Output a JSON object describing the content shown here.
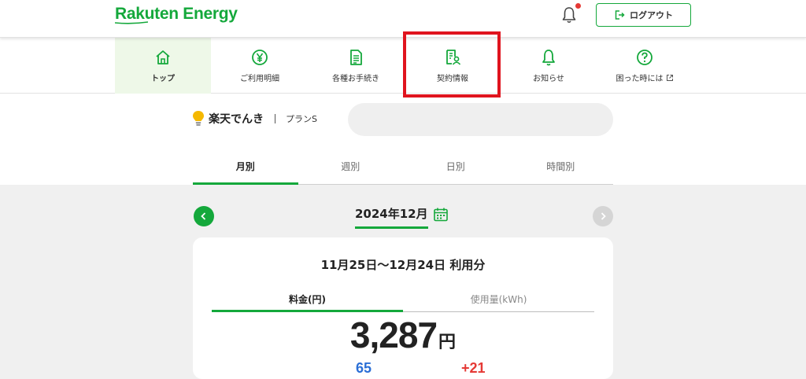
{
  "header": {
    "logo_text": "Rakuten Energy",
    "logout_label": "ログアウト",
    "brand_color": "#14a83b",
    "notification_dot_color": "#e53935"
  },
  "nav": {
    "items": [
      {
        "label": "トップ",
        "icon": "home-icon",
        "active": true
      },
      {
        "label": "ご利用明細",
        "icon": "yen-icon",
        "active": false
      },
      {
        "label": "各種お手続き",
        "icon": "document-icon",
        "active": false
      },
      {
        "label": "契約情報",
        "icon": "contract-icon",
        "active": false
      },
      {
        "label": "お知らせ",
        "icon": "bell-icon",
        "active": false
      },
      {
        "label": "困った時には",
        "icon": "help-icon",
        "active": false
      }
    ]
  },
  "service": {
    "name": "楽天でんき",
    "plan": "プランS"
  },
  "period_tabs": [
    "月別",
    "週別",
    "日別",
    "時間別"
  ],
  "period_tabs_active": "月別",
  "date_selector": {
    "label": "2024年12月"
  },
  "card": {
    "usage_period": "11月25日～12月24日 利用分",
    "tabs": [
      "料金(円)",
      "使用量(kWh)"
    ],
    "active_tab": "料金(円)",
    "amount": "3,287",
    "amount_unit": "円",
    "partial_blue": "65",
    "partial_red": "+21"
  },
  "highlight_color": "#e0141e"
}
